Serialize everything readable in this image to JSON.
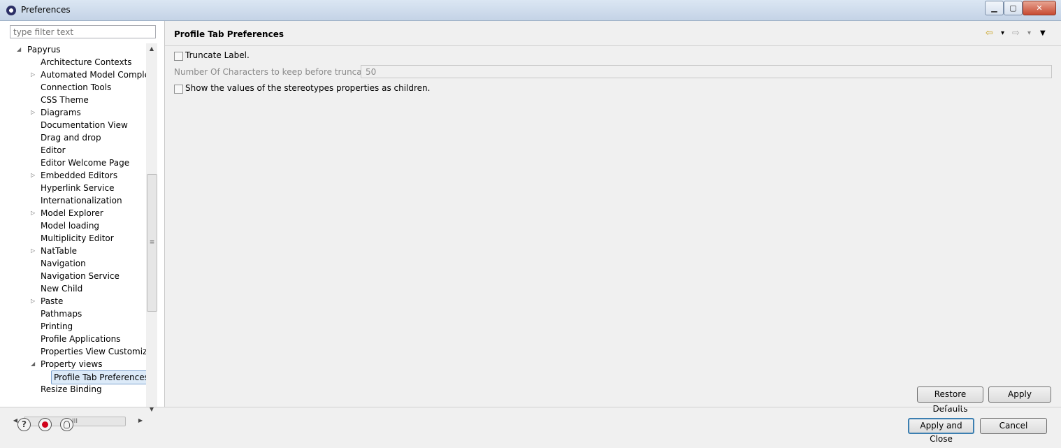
{
  "window": {
    "title": "Preferences",
    "minimize": "▁",
    "maximize": "▢",
    "close": "✕"
  },
  "sidebar": {
    "filter_placeholder": "type filter text",
    "root": "Papyrus",
    "items": [
      {
        "label": "Architecture Contexts",
        "expandable": false
      },
      {
        "label": "Automated Model Completi",
        "expandable": true
      },
      {
        "label": "Connection Tools",
        "expandable": false
      },
      {
        "label": "CSS Theme",
        "expandable": false
      },
      {
        "label": "Diagrams",
        "expandable": true
      },
      {
        "label": "Documentation View",
        "expandable": false
      },
      {
        "label": "Drag and drop",
        "expandable": false
      },
      {
        "label": "Editor",
        "expandable": false
      },
      {
        "label": "Editor Welcome Page",
        "expandable": false
      },
      {
        "label": "Embedded Editors",
        "expandable": true
      },
      {
        "label": "Hyperlink Service",
        "expandable": false
      },
      {
        "label": "Internationalization",
        "expandable": false
      },
      {
        "label": "Model Explorer",
        "expandable": true
      },
      {
        "label": "Model loading",
        "expandable": false
      },
      {
        "label": "Multiplicity Editor",
        "expandable": false
      },
      {
        "label": "NatTable",
        "expandable": true
      },
      {
        "label": "Navigation",
        "expandable": false
      },
      {
        "label": "Navigation Service",
        "expandable": false
      },
      {
        "label": "New Child",
        "expandable": false
      },
      {
        "label": "Paste",
        "expandable": true
      },
      {
        "label": "Pathmaps",
        "expandable": false
      },
      {
        "label": "Printing",
        "expandable": false
      },
      {
        "label": "Profile Applications",
        "expandable": false
      },
      {
        "label": "Properties View Customizatio",
        "expandable": false
      },
      {
        "label": "Property views",
        "expandable": true,
        "expanded": true
      },
      {
        "label": "Profile Tab Preferences",
        "child": true,
        "selected": true
      },
      {
        "label": "Resize Binding",
        "expandable": false
      }
    ],
    "hscroll_grip": "III",
    "vscroll_grip": "≡"
  },
  "page": {
    "title": "Profile Tab Preferences",
    "nav": {
      "back_icon": "⇦",
      "dropdown": "▾",
      "forward_icon": "⇨",
      "menu_icon": "▼"
    },
    "truncate_label": "Truncate Label.",
    "chars_label": "Number Of Characters to keep before truncating.",
    "chars_value": "50",
    "show_values_label": "Show the values of the stereotypes properties as children.",
    "restore_defaults": "Restore Defaults",
    "apply": "Apply"
  },
  "footer": {
    "help_icon": "?",
    "apply_close": "Apply and Close",
    "cancel": "Cancel"
  }
}
